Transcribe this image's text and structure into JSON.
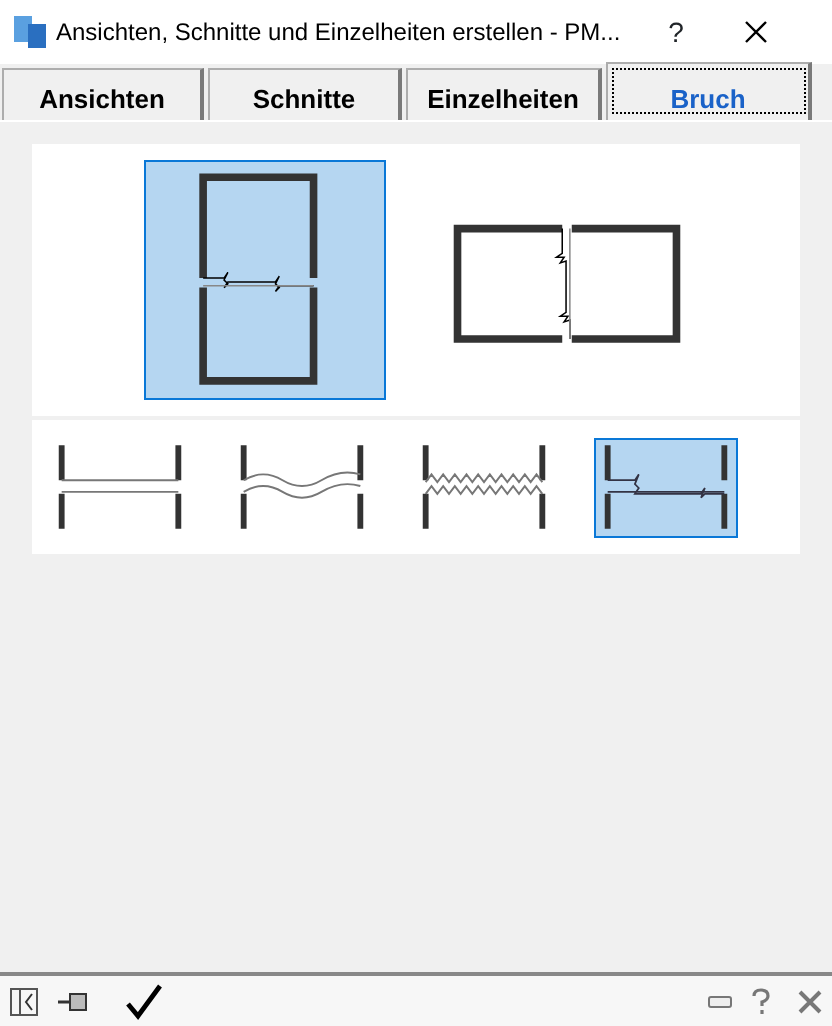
{
  "window": {
    "title": "Ansichten, Schnitte und Einzelheiten erstellen  -  PM...",
    "help": "?"
  },
  "tabs": [
    {
      "label": "Ansichten",
      "selected": false
    },
    {
      "label": "Schnitte",
      "selected": false
    },
    {
      "label": "Einzelheiten",
      "selected": false
    },
    {
      "label": "Bruch",
      "selected": true
    }
  ],
  "orientations": [
    {
      "kind": "vertical",
      "selected": true
    },
    {
      "kind": "horizontal",
      "selected": false
    }
  ],
  "break_styles": [
    {
      "kind": "straight",
      "selected": false
    },
    {
      "kind": "wave",
      "selected": false
    },
    {
      "kind": "zigzag",
      "selected": false
    },
    {
      "kind": "double-zig",
      "selected": true
    }
  ]
}
